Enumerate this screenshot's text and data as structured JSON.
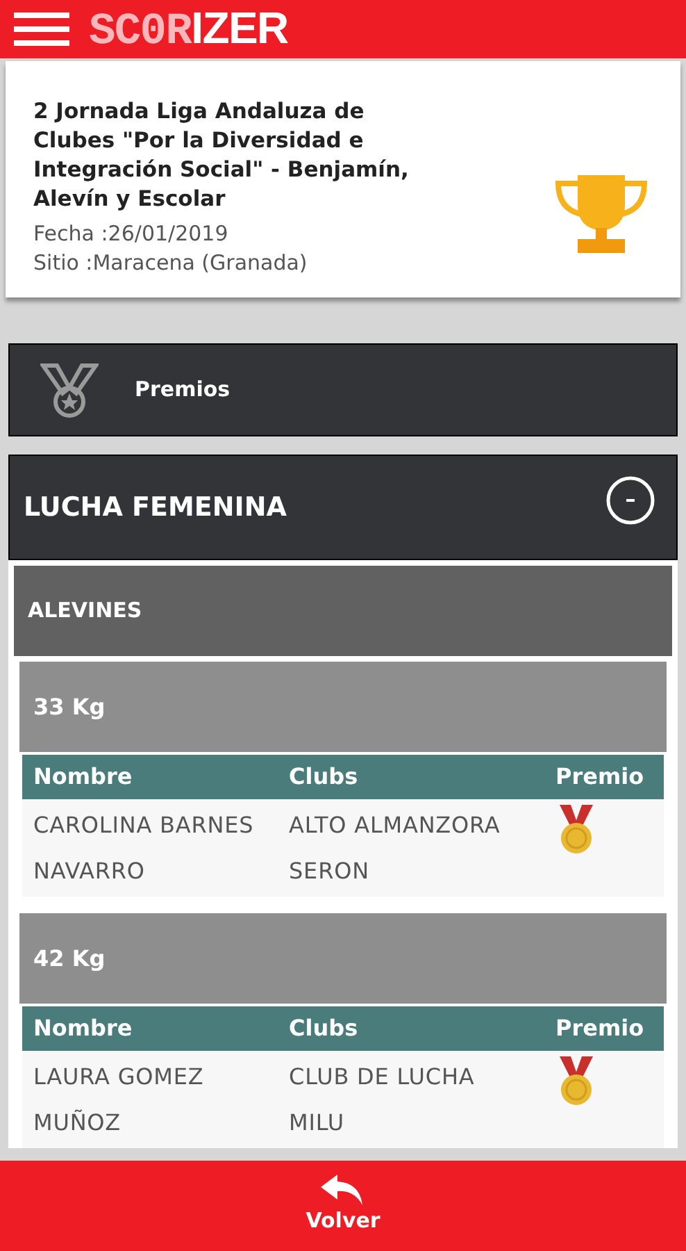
{
  "header": {
    "logo_light": "SC0R",
    "logo_bold": "IZER"
  },
  "event": {
    "title": "2 Jornada Liga Andaluza de Clubes \"Por la Diversidad e Integración Social\" - Benjamín, Alevín y Escolar",
    "date": "Fecha :26/01/2019",
    "place": "Sitio :Maracena (Granada)"
  },
  "prizes_bar": {
    "label": "Premios"
  },
  "section": {
    "title": "LUCHA FEMENINA",
    "expanded": true,
    "category": "ALEVINES",
    "groups": [
      {
        "weight": "33 Kg",
        "columns": [
          "Nombre",
          "Clubs",
          "Premio"
        ],
        "rows": [
          {
            "name": "CAROLINA BARNES NAVARRO",
            "club": "ALTO ALMANZORA SERON",
            "medal": true
          }
        ]
      },
      {
        "weight": "42 Kg",
        "columns": [
          "Nombre",
          "Clubs",
          "Premio"
        ],
        "rows": [
          {
            "name": "LAURA GOMEZ MUÑOZ",
            "club": "CLUB DE LUCHA MILU",
            "medal": true
          }
        ]
      }
    ]
  },
  "footer": {
    "back_label": "Volver"
  }
}
